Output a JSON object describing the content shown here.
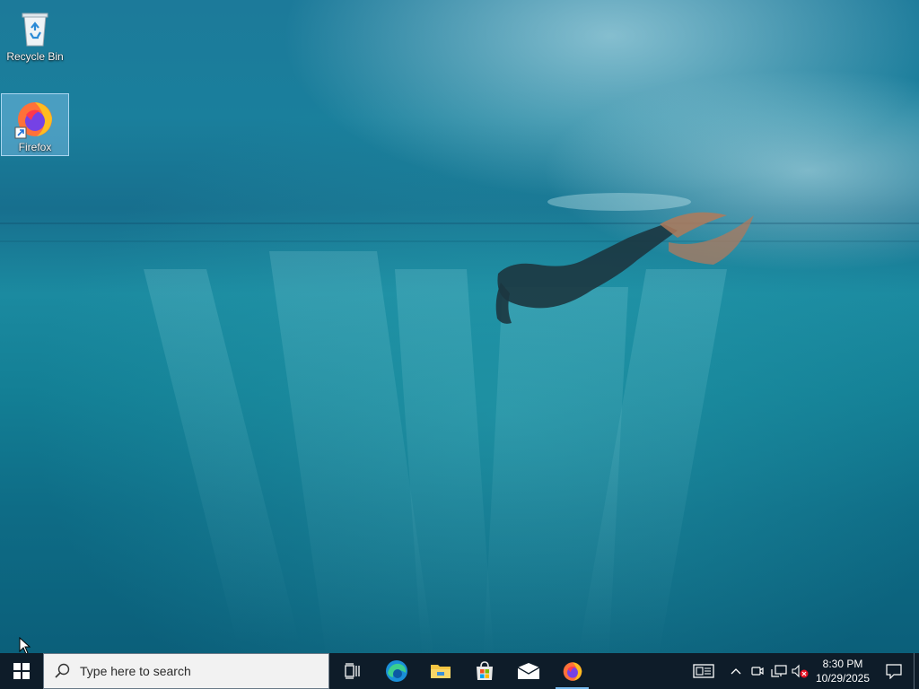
{
  "desktop": {
    "icons": [
      {
        "label": "Recycle Bin",
        "icon": "recycle-bin-icon"
      },
      {
        "label": "Firefox",
        "icon": "firefox-icon"
      }
    ]
  },
  "taskbar": {
    "search_placeholder": "Type here to search",
    "apps": [
      {
        "name": "Task View",
        "icon": "task-view-icon"
      },
      {
        "name": "Microsoft Edge",
        "icon": "edge-icon"
      },
      {
        "name": "File Explorer",
        "icon": "file-explorer-icon"
      },
      {
        "name": "Microsoft Store",
        "icon": "store-icon"
      },
      {
        "name": "Mail",
        "icon": "mail-icon"
      },
      {
        "name": "Firefox",
        "icon": "firefox-icon"
      }
    ],
    "tray": {
      "time": "8:30 PM",
      "date": "10/29/2025",
      "icons": [
        "news-icon",
        "chevron-up-icon",
        "meet-now-icon",
        "network-icon",
        "volume-muted-icon",
        "notification-icon"
      ]
    }
  },
  "colors": {
    "taskbar_bg": "#0e1c29",
    "search_bg": "#f2f2f2",
    "accent": "#0078d7"
  }
}
